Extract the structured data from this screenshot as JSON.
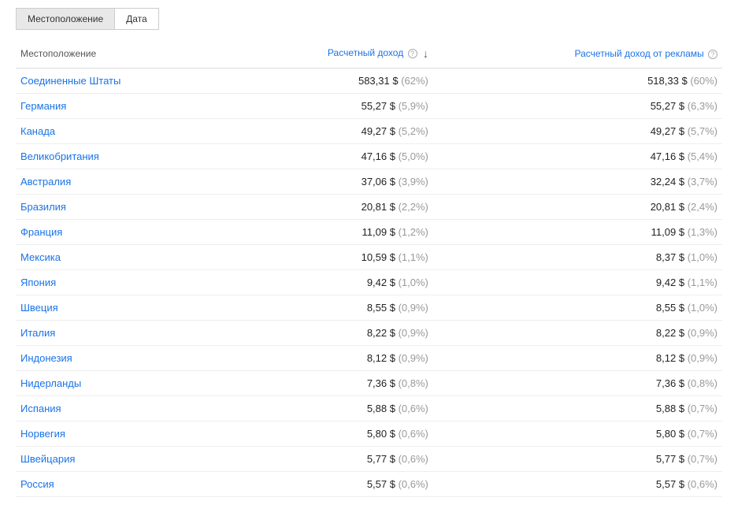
{
  "tabs": {
    "location": "Местоположение",
    "date": "Дата"
  },
  "headers": {
    "location": "Местоположение",
    "est_revenue": "Расчетный доход",
    "est_ad_revenue": "Расчетный доход от рекламы"
  },
  "icons": {
    "help": "?",
    "sort": "↓"
  },
  "rows": [
    {
      "loc": "Соединенные Штаты",
      "rev": "583,31 $",
      "rev_pct": "(62%)",
      "ad": "518,33 $",
      "ad_pct": "(60%)"
    },
    {
      "loc": "Германия",
      "rev": "55,27 $",
      "rev_pct": "(5,9%)",
      "ad": "55,27 $",
      "ad_pct": "(6,3%)"
    },
    {
      "loc": "Канада",
      "rev": "49,27 $",
      "rev_pct": "(5,2%)",
      "ad": "49,27 $",
      "ad_pct": "(5,7%)"
    },
    {
      "loc": "Великобритания",
      "rev": "47,16 $",
      "rev_pct": "(5,0%)",
      "ad": "47,16 $",
      "ad_pct": "(5,4%)"
    },
    {
      "loc": "Австралия",
      "rev": "37,06 $",
      "rev_pct": "(3,9%)",
      "ad": "32,24 $",
      "ad_pct": "(3,7%)"
    },
    {
      "loc": "Бразилия",
      "rev": "20,81 $",
      "rev_pct": "(2,2%)",
      "ad": "20,81 $",
      "ad_pct": "(2,4%)"
    },
    {
      "loc": "Франция",
      "rev": "11,09 $",
      "rev_pct": "(1,2%)",
      "ad": "11,09 $",
      "ad_pct": "(1,3%)"
    },
    {
      "loc": "Мексика",
      "rev": "10,59 $",
      "rev_pct": "(1,1%)",
      "ad": "8,37 $",
      "ad_pct": "(1,0%)"
    },
    {
      "loc": "Япония",
      "rev": "9,42 $",
      "rev_pct": "(1,0%)",
      "ad": "9,42 $",
      "ad_pct": "(1,1%)"
    },
    {
      "loc": "Швеция",
      "rev": "8,55 $",
      "rev_pct": "(0,9%)",
      "ad": "8,55 $",
      "ad_pct": "(1,0%)"
    },
    {
      "loc": "Италия",
      "rev": "8,22 $",
      "rev_pct": "(0,9%)",
      "ad": "8,22 $",
      "ad_pct": "(0,9%)"
    },
    {
      "loc": "Индонезия",
      "rev": "8,12 $",
      "rev_pct": "(0,9%)",
      "ad": "8,12 $",
      "ad_pct": "(0,9%)"
    },
    {
      "loc": "Нидерланды",
      "rev": "7,36 $",
      "rev_pct": "(0,8%)",
      "ad": "7,36 $",
      "ad_pct": "(0,8%)"
    },
    {
      "loc": "Испания",
      "rev": "5,88 $",
      "rev_pct": "(0,6%)",
      "ad": "5,88 $",
      "ad_pct": "(0,7%)"
    },
    {
      "loc": "Норвегия",
      "rev": "5,80 $",
      "rev_pct": "(0,6%)",
      "ad": "5,80 $",
      "ad_pct": "(0,7%)"
    },
    {
      "loc": "Швейцария",
      "rev": "5,77 $",
      "rev_pct": "(0,6%)",
      "ad": "5,77 $",
      "ad_pct": "(0,7%)"
    },
    {
      "loc": "Россия",
      "rev": "5,57 $",
      "rev_pct": "(0,6%)",
      "ad": "5,57 $",
      "ad_pct": "(0,6%)"
    }
  ]
}
